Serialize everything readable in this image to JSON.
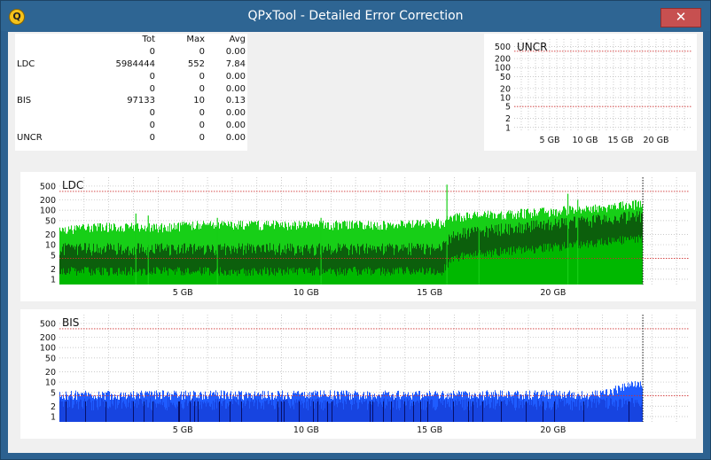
{
  "window": {
    "title": "QPxTool - Detailed Error Correction",
    "close_glyph": "✕",
    "app_icon_glyph": "Q"
  },
  "stats": {
    "headers": [
      "",
      "Tot",
      "Max",
      "Avg"
    ],
    "rows": [
      {
        "label": "",
        "tot": "0",
        "max": "0",
        "avg": "0.00"
      },
      {
        "label": "LDC",
        "tot": "5984444",
        "max": "552",
        "avg": "7.84"
      },
      {
        "label": "",
        "tot": "0",
        "max": "0",
        "avg": "0.00"
      },
      {
        "label": "",
        "tot": "0",
        "max": "0",
        "avg": "0.00"
      },
      {
        "label": "BIS",
        "tot": "97133",
        "max": "10",
        "avg": "0.13"
      },
      {
        "label": "",
        "tot": "0",
        "max": "0",
        "avg": "0.00"
      },
      {
        "label": "",
        "tot": "0",
        "max": "0",
        "avg": "0.00"
      },
      {
        "label": "UNCR",
        "tot": "0",
        "max": "0",
        "avg": "0.00"
      }
    ]
  },
  "chart_data": [
    {
      "type": "area",
      "title": "UNCR",
      "y_scale": "log",
      "y_ticks": [
        "500",
        "200",
        "100",
        "50",
        "20",
        "10",
        "5",
        "2",
        "1"
      ],
      "x_ticks": [
        "5 GB",
        "10 GB",
        "15 GB",
        "20 GB"
      ],
      "x_tick_values_gb": [
        5,
        10,
        15,
        20
      ],
      "xlim_gb": [
        0,
        25
      ],
      "threshold_lines": [
        350,
        5
      ],
      "series": [
        {
          "values": [
            0,
            0,
            0,
            0,
            0
          ]
        }
      ],
      "colors": {
        "grid": "#b8b8b8",
        "threshold": "#d03030"
      }
    },
    {
      "type": "area",
      "title": "LDC",
      "y_scale": "log",
      "y_ticks": [
        "500",
        "200",
        "100",
        "50",
        "20",
        "10",
        "5",
        "2",
        "1"
      ],
      "x_ticks": [
        "5 GB",
        "10 GB",
        "15 GB",
        "20 GB"
      ],
      "x_tick_values_gb": [
        5,
        10,
        15,
        20
      ],
      "xlim_gb": [
        0,
        25.5
      ],
      "end_marker_gb": 23.6,
      "threshold_lines": [
        350,
        4
      ],
      "max_value": 552,
      "series": [
        {
          "role": "max",
          "x_gb": [
            0,
            2,
            4,
            6,
            8,
            10,
            12,
            14,
            15.5,
            16,
            18,
            20,
            22,
            23.5
          ],
          "values": [
            25,
            30,
            30,
            35,
            35,
            35,
            35,
            35,
            40,
            60,
            70,
            85,
            110,
            140
          ]
        },
        {
          "role": "avg",
          "x_gb": [
            0,
            2,
            4,
            6,
            8,
            10,
            12,
            14,
            15.5,
            16,
            18,
            20,
            22,
            23.5
          ],
          "values": [
            8,
            8,
            8,
            8,
            8,
            8,
            8,
            8,
            8,
            20,
            30,
            40,
            55,
            70
          ]
        }
      ],
      "spikes": [
        {
          "x_gb": 3.1,
          "value": 80
        },
        {
          "x_gb": 3.6,
          "value": 70
        },
        {
          "x_gb": 6.4,
          "value": 60
        },
        {
          "x_gb": 10.6,
          "value": 60
        },
        {
          "x_gb": 15.7,
          "value": 550
        },
        {
          "x_gb": 17.0,
          "value": 60
        },
        {
          "x_gb": 20.6,
          "value": 300
        },
        {
          "x_gb": 21.0,
          "value": 200
        }
      ],
      "colors": {
        "max": "#17cf17",
        "avg": "#0c5f0c",
        "base": "#00b800",
        "grid": "#b8b8b8",
        "threshold": "#d03030"
      }
    },
    {
      "type": "area",
      "title": "BIS",
      "y_scale": "log",
      "y_ticks": [
        "500",
        "200",
        "100",
        "50",
        "20",
        "10",
        "5",
        "2",
        "1"
      ],
      "x_ticks": [
        "5 GB",
        "10 GB",
        "15 GB",
        "20 GB"
      ],
      "x_tick_values_gb": [
        5,
        10,
        15,
        20
      ],
      "xlim_gb": [
        0,
        25.5
      ],
      "end_marker_gb": 23.6,
      "threshold_lines": [
        350,
        4
      ],
      "max_value": 10,
      "series": [
        {
          "role": "max",
          "x_gb": [
            0,
            4,
            8,
            12,
            16,
            20,
            22,
            23.4
          ],
          "values": [
            4,
            4,
            4,
            4,
            4,
            4,
            4,
            8
          ]
        },
        {
          "role": "avg",
          "x_gb": [
            0,
            4,
            8,
            12,
            16,
            20,
            22,
            23.4
          ],
          "values": [
            2.5,
            2.5,
            2.5,
            2.5,
            2.5,
            2.5,
            2.5,
            2.5
          ]
        }
      ],
      "colors": {
        "max": "#1f5cff",
        "avg": "#1744e0",
        "dark": "#06106a",
        "grid": "#b8b8b8",
        "threshold": "#d03030"
      }
    }
  ]
}
